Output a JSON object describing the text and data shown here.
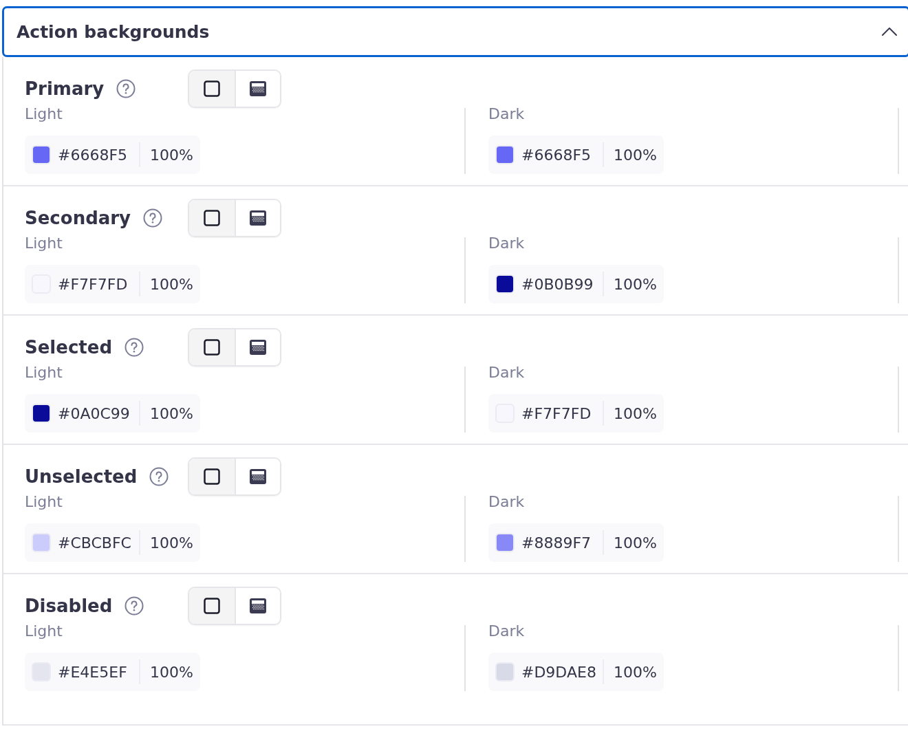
{
  "panel": {
    "title": "Action backgrounds",
    "expanded": true
  },
  "groups": [
    {
      "name": "Primary",
      "modes": [
        {
          "kind": "solid",
          "selected": true
        },
        {
          "kind": "gradient",
          "selected": false
        }
      ],
      "variants": [
        {
          "label": "Light",
          "hex": "#6668F5",
          "color": "#6668f5",
          "opacity": "100%"
        },
        {
          "label": "Dark",
          "hex": "#6668F5",
          "color": "#6668f5",
          "opacity": "100%"
        }
      ]
    },
    {
      "name": "Secondary",
      "modes": [
        {
          "kind": "solid",
          "selected": true
        },
        {
          "kind": "gradient",
          "selected": false
        }
      ],
      "variants": [
        {
          "label": "Light",
          "hex": "#F7F7FD",
          "color": "#f7f7fd",
          "opacity": "100%"
        },
        {
          "label": "Dark",
          "hex": "#0B0B99",
          "color": "#0b0b99",
          "opacity": "100%"
        }
      ]
    },
    {
      "name": "Selected",
      "modes": [
        {
          "kind": "solid",
          "selected": true
        },
        {
          "kind": "gradient",
          "selected": false
        }
      ],
      "variants": [
        {
          "label": "Light",
          "hex": "#0A0C99",
          "color": "#0a0c99",
          "opacity": "100%"
        },
        {
          "label": "Dark",
          "hex": "#F7F7FD",
          "color": "#f7f7fd",
          "opacity": "100%"
        }
      ]
    },
    {
      "name": "Unselected",
      "modes": [
        {
          "kind": "solid",
          "selected": true
        },
        {
          "kind": "gradient",
          "selected": false
        }
      ],
      "variants": [
        {
          "label": "Light",
          "hex": "#CBCBFC",
          "color": "#cbcbfc",
          "opacity": "100%"
        },
        {
          "label": "Dark",
          "hex": "#8889F7",
          "color": "#8889f7",
          "opacity": "100%"
        }
      ]
    },
    {
      "name": "Disabled",
      "modes": [
        {
          "kind": "solid",
          "selected": true
        },
        {
          "kind": "gradient",
          "selected": false
        }
      ],
      "variants": [
        {
          "label": "Light",
          "hex": "#E4E5EF",
          "color": "#e4e5ef",
          "opacity": "100%"
        },
        {
          "label": "Dark",
          "hex": "#D9DAE8",
          "color": "#d9dae8",
          "opacity": "100%"
        }
      ]
    }
  ]
}
